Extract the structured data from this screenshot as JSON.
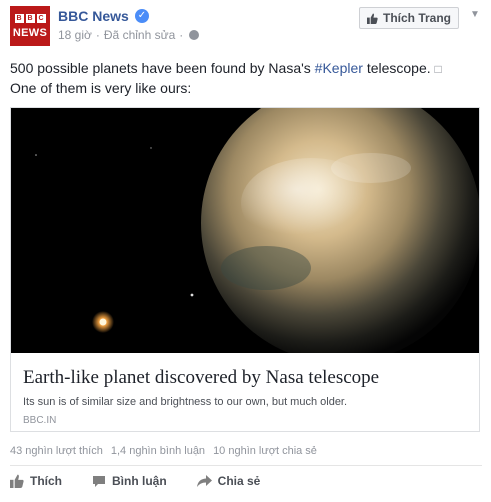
{
  "post": {
    "page_name": "BBC News",
    "avatar_letters": [
      "B",
      "B",
      "C"
    ],
    "avatar_word": "NEWS",
    "time": "18 giờ",
    "edited": "Đã chỉnh sửa",
    "separator": "·",
    "like_page_label": "Thích Trang",
    "text_before": "500 possible planets have been found by Nasa's ",
    "hashtag": "#Kepler",
    "text_after": " telescope.",
    "text_glyph": "□",
    "text_line2": "One of them is very like ours:",
    "icons": [
      "verified-badge-icon",
      "globe-icon",
      "thumbs-up-icon",
      "chevron-down-icon",
      "comment-icon",
      "share-icon"
    ]
  },
  "card": {
    "title": "Earth-like planet discovered by Nasa telescope",
    "description": "Its sun is of similar size and brightness to our own, but much older.",
    "domain": "BBC.IN"
  },
  "stats": {
    "likes": "43 nghìn lượt thích",
    "comments": "1,4 nghìn bình luận",
    "shares": "10 nghìn lượt chia sẻ"
  },
  "actions": {
    "like": "Thích",
    "comment": "Bình luận",
    "share": "Chia sẻ"
  },
  "colors": {
    "brand_red": "#bb1919",
    "link_blue": "#365899",
    "meta_gray": "#90949c"
  }
}
